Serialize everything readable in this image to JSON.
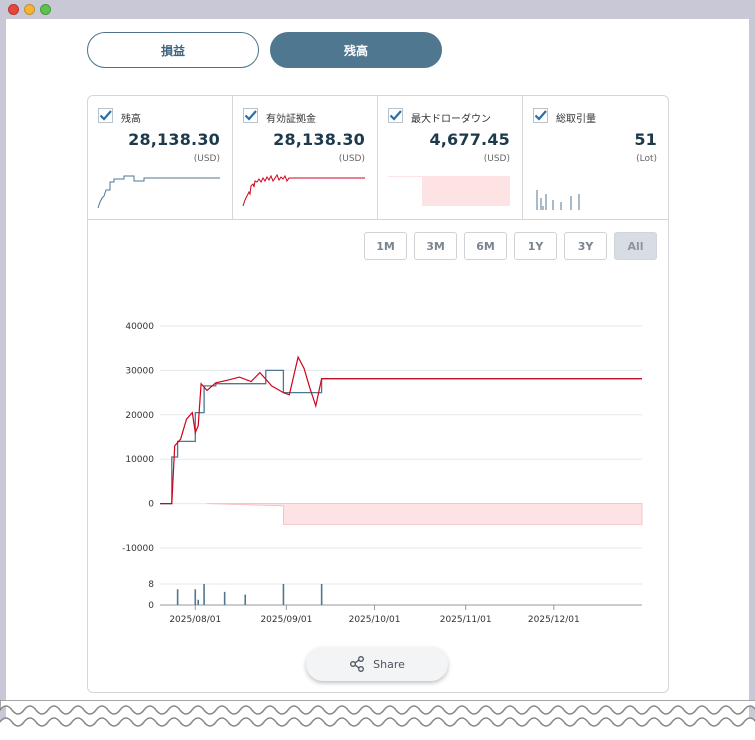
{
  "tabs": {
    "pl_label": "損益",
    "balance_label": "残高"
  },
  "cards": [
    {
      "label": "残高",
      "value": "28,138.30",
      "unit": "(USD)"
    },
    {
      "label": "有効証拠金",
      "value": "28,138.30",
      "unit": "(USD)"
    },
    {
      "label": "最大ドローダウン",
      "value": "4,677.45",
      "unit": "(USD)"
    },
    {
      "label": "総取引量",
      "value": "51",
      "unit": "(Lot)"
    }
  ],
  "ranges": [
    "1M",
    "3M",
    "6M",
    "1Y",
    "3Y",
    "All"
  ],
  "active_range": "All",
  "share_label": "Share",
  "colors": {
    "balance": "#4f7790",
    "equity": "#d0021b",
    "drawdown": "#fde3e4",
    "volume": "#4f7790"
  },
  "chart_data": {
    "type": "line",
    "x_ticks": [
      "2025/08/01",
      "2025/09/01",
      "2025/10/01",
      "2025/11/01",
      "2025/12/01"
    ],
    "y_ticks": [
      40000,
      30000,
      20000,
      10000,
      0,
      -10000
    ],
    "ylim": [
      -10000,
      40000
    ],
    "volume_ticks": [
      8,
      0
    ],
    "series": [
      {
        "name": "残高",
        "points": [
          [
            "2025/07/20",
            0
          ],
          [
            "2025/07/24",
            0
          ],
          [
            "2025/07/24",
            10500
          ],
          [
            "2025/07/26",
            10500
          ],
          [
            "2025/07/26",
            14000
          ],
          [
            "2025/08/01",
            14000
          ],
          [
            "2025/08/01",
            20500
          ],
          [
            "2025/08/04",
            20500
          ],
          [
            "2025/08/04",
            26500
          ],
          [
            "2025/08/08",
            26500
          ],
          [
            "2025/08/08",
            27000
          ],
          [
            "2025/08/25",
            27000
          ],
          [
            "2025/08/25",
            30000
          ],
          [
            "2025/08/31",
            30000
          ],
          [
            "2025/08/31",
            25000
          ],
          [
            "2025/09/13",
            25000
          ],
          [
            "2025/09/13",
            28138
          ],
          [
            "2025/12/31",
            28138
          ]
        ]
      },
      {
        "name": "有効証拠金",
        "points": [
          [
            "2025/07/20",
            0
          ],
          [
            "2025/07/24",
            0
          ],
          [
            "2025/07/25",
            13000
          ],
          [
            "2025/07/27",
            14500
          ],
          [
            "2025/07/29",
            19000
          ],
          [
            "2025/07/31",
            20500
          ],
          [
            "2025/08/01",
            16000
          ],
          [
            "2025/08/02",
            17500
          ],
          [
            "2025/08/03",
            27000
          ],
          [
            "2025/08/05",
            25500
          ],
          [
            "2025/08/08",
            27200
          ],
          [
            "2025/08/12",
            27800
          ],
          [
            "2025/08/16",
            28500
          ],
          [
            "2025/08/20",
            27500
          ],
          [
            "2025/08/23",
            29500
          ],
          [
            "2025/08/27",
            26500
          ],
          [
            "2025/08/31",
            25000
          ],
          [
            "2025/09/02",
            24500
          ],
          [
            "2025/09/05",
            33000
          ],
          [
            "2025/09/07",
            30500
          ],
          [
            "2025/09/09",
            26000
          ],
          [
            "2025/09/11",
            22000
          ],
          [
            "2025/09/13",
            28138
          ],
          [
            "2025/12/31",
            28138
          ]
        ]
      },
      {
        "name": "最大ドローダウン",
        "points": [
          [
            "2025/08/05",
            0
          ],
          [
            "2025/08/31",
            -500
          ],
          [
            "2025/08/31",
            -4677
          ],
          [
            "2025/12/31",
            -4677
          ]
        ]
      }
    ],
    "volume": [
      [
        "2025/07/26",
        6
      ],
      [
        "2025/08/01",
        6
      ],
      [
        "2025/08/02",
        2
      ],
      [
        "2025/08/04",
        8
      ],
      [
        "2025/08/11",
        5
      ],
      [
        "2025/08/18",
        4
      ],
      [
        "2025/08/31",
        8
      ],
      [
        "2025/09/13",
        8
      ]
    ]
  }
}
